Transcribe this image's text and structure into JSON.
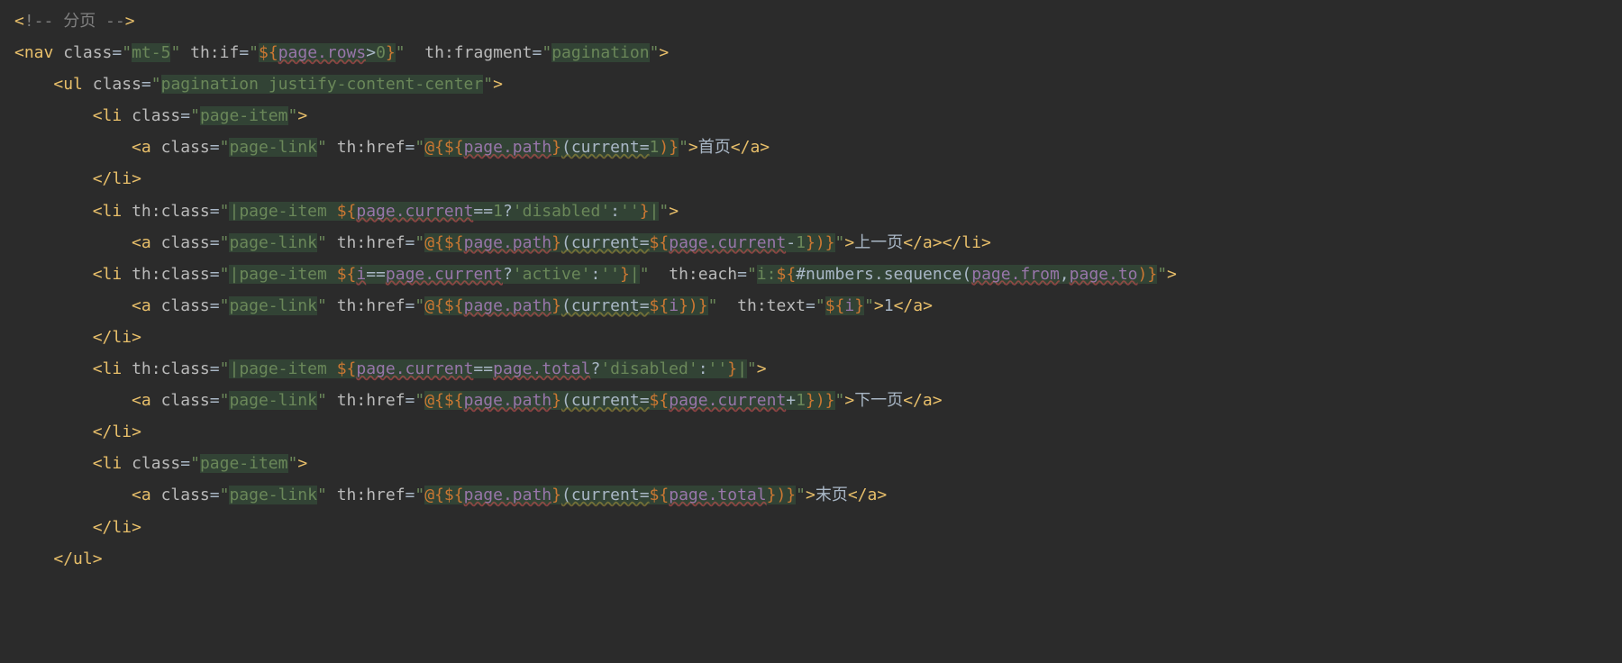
{
  "editor": {
    "language": "HTML (Thymeleaf)",
    "comment": "!-- 分页 --",
    "lines": [
      {
        "indent": 0,
        "raw": "<!-- 分页 -->"
      },
      {
        "indent": 0,
        "raw": "<nav class=\"mt-5\" th:if=\"${page.rows>0}\" th:fragment=\"pagination\">"
      },
      {
        "indent": 1,
        "raw": "<ul class=\"pagination justify-content-center\">"
      },
      {
        "indent": 2,
        "raw": "<li class=\"page-item\">"
      },
      {
        "indent": 3,
        "raw": "<a class=\"page-link\" th:href=\"@{${page.path}(current=1)}\">首页</a>"
      },
      {
        "indent": 2,
        "raw": "</li>"
      },
      {
        "indent": 2,
        "raw": "<li th:class=\"|page-item ${page.current==1?'disabled':''}|\">"
      },
      {
        "indent": 3,
        "raw": "<a class=\"page-link\" th:href=\"@{${page.path}(current=${page.current-1})}\">上一页</a></li>"
      },
      {
        "indent": 2,
        "raw": "<li th:class=\"|page-item ${i==page.current?'active':''}|\" th:each=\"i:${#numbers.sequence(page.from,page.to)}\">"
      },
      {
        "indent": 3,
        "raw": "<a class=\"page-link\" th:href=\"@{${page.path}(current=${i})}\" th:text=\"${i}\">1</a>"
      },
      {
        "indent": 2,
        "raw": "</li>"
      },
      {
        "indent": 2,
        "raw": "<li th:class=\"|page-item ${page.current==page.total?'disabled':''}|\">"
      },
      {
        "indent": 3,
        "raw": "<a class=\"page-link\" th:href=\"@{${page.path}(current=${page.current+1})}\">下一页</a>"
      },
      {
        "indent": 2,
        "raw": "</li>"
      },
      {
        "indent": 2,
        "raw": "<li class=\"page-item\">"
      },
      {
        "indent": 3,
        "raw": "<a class=\"page-link\" th:href=\"@{${page.path}(current=${page.total})}\">末页</a>"
      },
      {
        "indent": 2,
        "raw": "</li>"
      },
      {
        "indent": 1,
        "raw": "</ul>"
      }
    ],
    "tokens": {
      "commentOpen": "<",
      "commentBody": "!-- 分页 --",
      "commentClose": ">",
      "nav": "nav",
      "ul": "ul",
      "li": "li",
      "a": "a",
      "class": "class",
      "thIf": "th:if",
      "thFragment": "th:fragment",
      "thClass": "th:class",
      "thHref": "th:href",
      "thEach": "th:each",
      "thText": "th:text",
      "mt5": "mt-5",
      "pagination": "pagination",
      "paginationJustify": "pagination justify-content-center",
      "pageItem": "page-item",
      "pageLink": "page-link",
      "exprRowsGt0_a": "${",
      "exprRowsGt0_b": "page.rows",
      "exprRowsGt0_c": ">",
      "exprRowsGt0_d": "0",
      "exprRowsGt0_e": "}",
      "hrefFirst_a": "@{",
      "hrefFirst_b": "${",
      "hrefFirst_c": "page.path",
      "hrefFirst_d": "}",
      "hrefFirst_e": "(current=",
      "hrefFirst_f": "1",
      "hrefFirst_g": ")}",
      "textFirst": "首页",
      "pipeOpen": "|",
      "classDisabled_a": "page-item ",
      "classDisabled_b": "${",
      "classDisabled_c": "page.current",
      "classDisabled_d": "==",
      "classDisabled_e": "1",
      "classDisabled_f": "?",
      "classDisabled_g": "'disabled'",
      "classDisabled_h": ":",
      "classDisabled_i": "''",
      "classDisabled_j": "}",
      "hrefPrev_e": "(current=",
      "hrefPrev_f": "${",
      "hrefPrev_g": "page.current",
      "hrefPrev_h": "-",
      "hrefPrev_i": "1",
      "hrefPrev_j": "}",
      "hrefPrev_k": ")}",
      "textPrev": "上一页",
      "classActive_c": "i",
      "classActive_dd": "==",
      "classActive_e": "page.current",
      "classActive_g": "'active'",
      "each_a": "i:",
      "each_b": "${",
      "each_c": "#numbers.sequence(",
      "each_d": "page.from",
      "each_e": ",",
      "each_f": "page.to",
      "each_g": ")}",
      "hrefI_f": "${",
      "hrefI_g": "i",
      "hrefI_h": "}",
      "textI_a": "${",
      "textI_b": "i",
      "textI_c": "}",
      "one": "1",
      "classTotal_e": "page.total",
      "hrefNext_g2": "+",
      "textNext": "下一页",
      "hrefLast_f": "${",
      "hrefLast_g": "page.total",
      "hrefLast_h": "}",
      "textLast": "末页"
    }
  }
}
